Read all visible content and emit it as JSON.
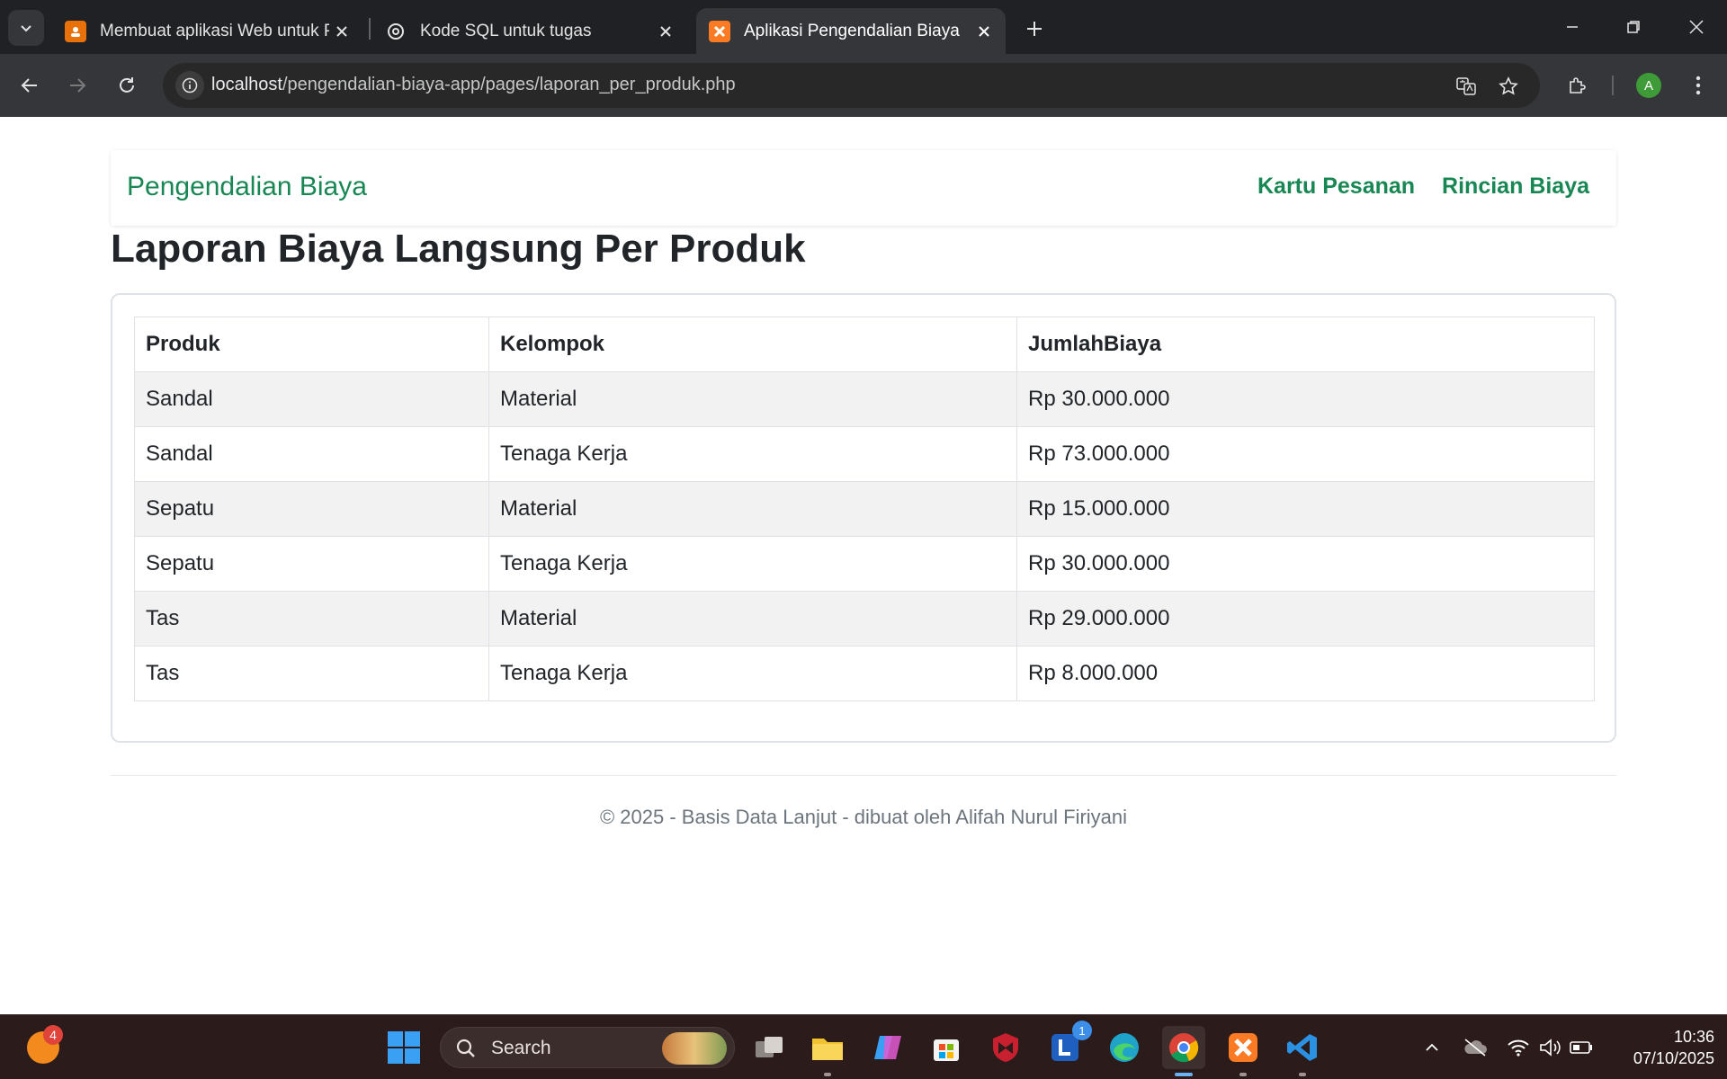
{
  "browser": {
    "tabs": [
      {
        "title": "Membuat aplikasi Web untuk P",
        "icon": "slides-icon",
        "active": false
      },
      {
        "title": "Kode SQL untuk tugas",
        "icon": "chatgpt-icon",
        "active": false
      },
      {
        "title": "Aplikasi Pengendalian Biaya",
        "icon": "xampp-icon",
        "active": true
      }
    ],
    "url_host": "localhost",
    "url_path": "/pengendalian-biaya-app/pages/laporan_per_produk.php",
    "profile_initial": "A"
  },
  "navbar": {
    "brand": "Pengendalian Biaya",
    "links": [
      {
        "label": "Kartu Pesanan"
      },
      {
        "label": "Rincian Biaya"
      }
    ]
  },
  "page": {
    "title": "Laporan Biaya Langsung Per Produk"
  },
  "table": {
    "headers": [
      "Produk",
      "Kelompok",
      "JumlahBiaya"
    ],
    "rows": [
      [
        "Sandal",
        "Material",
        "Rp 30.000.000"
      ],
      [
        "Sandal",
        "Tenaga Kerja",
        "Rp 73.000.000"
      ],
      [
        "Sepatu",
        "Material",
        "Rp 15.000.000"
      ],
      [
        "Sepatu",
        "Tenaga Kerja",
        "Rp 30.000.000"
      ],
      [
        "Tas",
        "Material",
        "Rp 29.000.000"
      ],
      [
        "Tas",
        "Tenaga Kerja",
        "Rp 8.000.000"
      ]
    ]
  },
  "footer": {
    "text": "© 2025 - Basis Data Lanjut - dibuat oleh Alifah Nurul Firiyani"
  },
  "taskbar": {
    "widget_badge": "4",
    "search_label": "Search",
    "lens_badge": "1",
    "time": "10:36",
    "date": "07/10/2025"
  },
  "colors": {
    "accent": "#198754",
    "chrome_dark": "#202124",
    "taskbar": "#2b1b1a"
  }
}
